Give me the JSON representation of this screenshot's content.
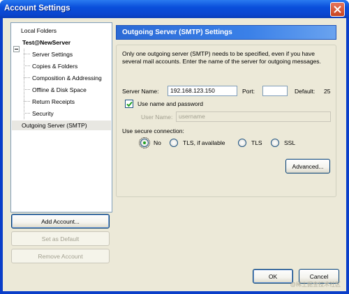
{
  "window": {
    "title": "Account Settings"
  },
  "tree": {
    "items": [
      {
        "label": "Local Folders"
      },
      {
        "label": "Test@NewServer"
      },
      {
        "label": "Server Settings"
      },
      {
        "label": "Copies & Folders"
      },
      {
        "label": "Composition & Addressing"
      },
      {
        "label": "Offline & Disk Space"
      },
      {
        "label": "Return Receipts"
      },
      {
        "label": "Security"
      },
      {
        "label": "Outgoing Server (SMTP)"
      }
    ]
  },
  "left_buttons": {
    "add_account": "Add Account...",
    "set_default": "Set as Default",
    "remove_account": "Remove Account"
  },
  "panel": {
    "title": "Outgoing Server (SMTP) Settings",
    "description": "Only one outgoing server (SMTP) needs to be specified, even if you have several mail accounts. Enter the name of the server for outgoing messages.",
    "server_name_label": "Server Name:",
    "server_name_value": "192.168.123.150",
    "port_label": "Port:",
    "port_value": "",
    "default_label": "Default:",
    "default_value": "25",
    "use_name_password_label": "Use name and password",
    "use_name_password_checked": true,
    "user_name_label": "User Name:",
    "user_name_value": "username",
    "secure_label": "Use secure connection:",
    "secure_options": [
      "No",
      "TLS, if available",
      "TLS",
      "SSL"
    ],
    "secure_selected": "No",
    "advanced_button": "Advanced..."
  },
  "dialog_buttons": {
    "ok": "OK",
    "cancel": "Cancel"
  },
  "watermark": "@稀土掘金技术社区",
  "colors": {
    "title_bar": "#0a4fdb",
    "panel_header": "#3a80e8",
    "face": "#ece9d8"
  }
}
